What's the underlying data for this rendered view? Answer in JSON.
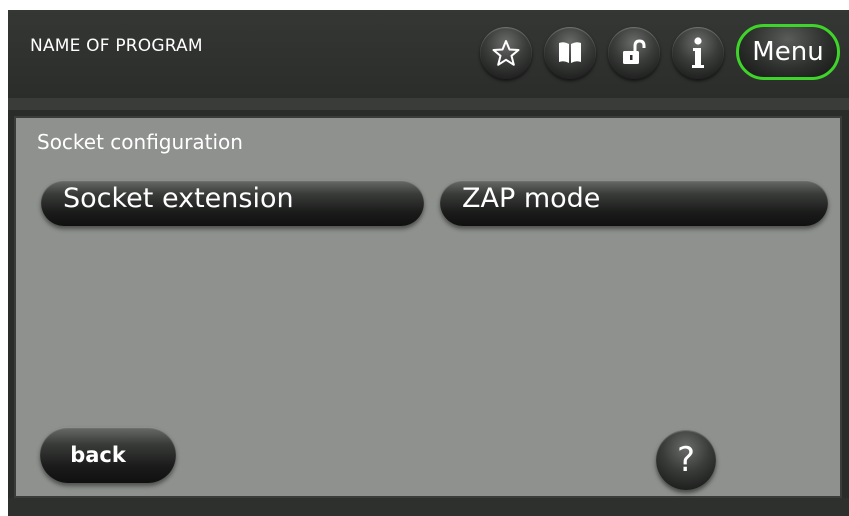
{
  "header": {
    "program_title": "NAME OF PROGRAM",
    "icons": [
      "star-icon",
      "book-icon",
      "unlock-icon",
      "info-icon"
    ],
    "menu_label": "Menu"
  },
  "main": {
    "section_label": "Socket configuration",
    "buttons": [
      {
        "label": "Socket extension"
      },
      {
        "label": "ZAP mode"
      }
    ]
  },
  "footer": {
    "back_label": "back",
    "help_label": "?"
  },
  "colors": {
    "panel": "#8e918d",
    "topbar": "#2b2d2b",
    "menu_outline": "#3ed42a"
  }
}
